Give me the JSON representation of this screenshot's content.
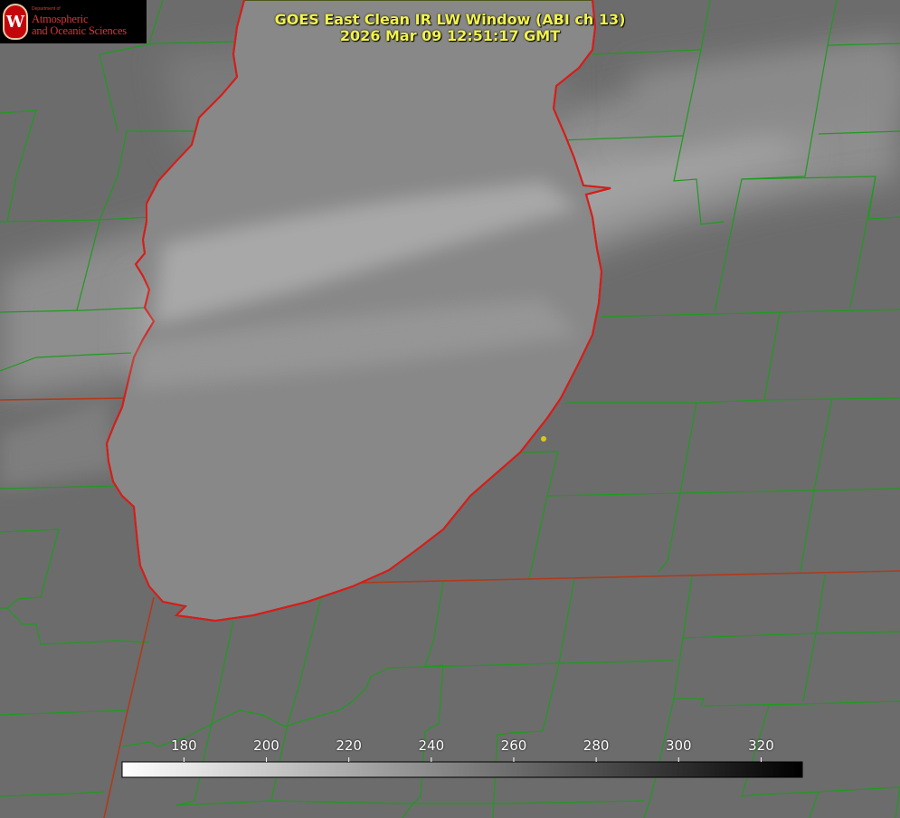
{
  "logo": {
    "department_line": "Department of",
    "name_line_1": "Atmospheric",
    "name_line_2": "and Oceanic Sciences",
    "seal_letter": "W",
    "seal_color": "#c5050c",
    "text_color": "#d8353a"
  },
  "header": {
    "title": "GOES East Clean IR LW Window (ABI ch 13)",
    "timestamp": "2026 Mar 09 12:51:17 GMT",
    "color": "#f2f24a"
  },
  "colorbar": {
    "min": 165,
    "max": 330,
    "ticks": [
      180,
      200,
      220,
      240,
      260,
      280,
      300,
      320
    ],
    "start_color": "#ffffff",
    "end_color": "#000000"
  },
  "map_style": {
    "county_line_color": "#1f9a1f",
    "state_line_color": "#b03a1a",
    "lake_outline_color": "#e01818",
    "marker_color": "#d8c81a"
  }
}
